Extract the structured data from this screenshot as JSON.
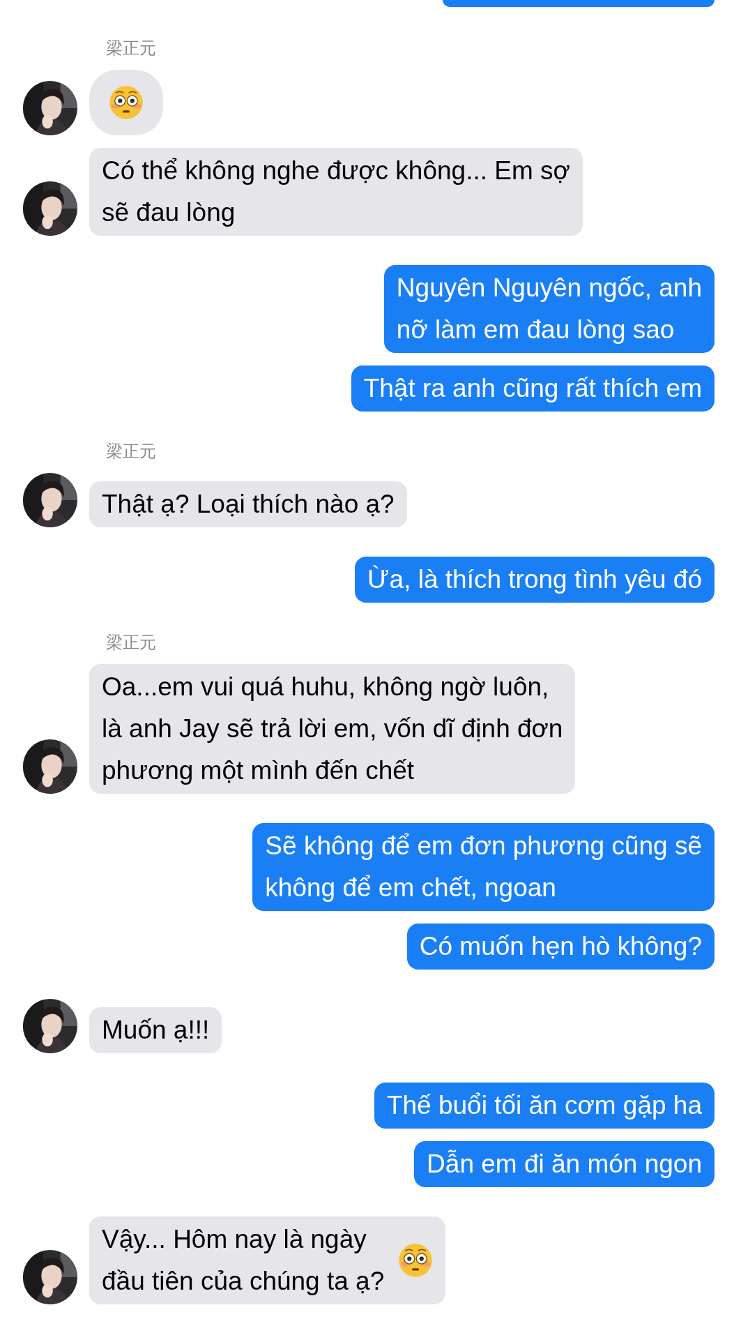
{
  "messages": [
    {
      "kind": "name",
      "text": "梁正元"
    },
    {
      "kind": "incoming",
      "emoji": true
    },
    {
      "kind": "incoming",
      "lines": [
        "Có thể không nghe được không... Em sợ",
        "sẽ đau lòng"
      ]
    },
    {
      "kind": "outgoing",
      "lines": [
        "Nguyên Nguyên ngốc, anh",
        "nỡ làm em đau lòng sao"
      ]
    },
    {
      "kind": "outgoing",
      "lines": [
        "Thật ra anh cũng rất thích em"
      ]
    },
    {
      "kind": "name",
      "text": "梁正元"
    },
    {
      "kind": "incoming",
      "lines": [
        "Thật ạ? Loại thích nào ạ?"
      ]
    },
    {
      "kind": "outgoing",
      "lines": [
        "Ừa, là thích trong tình yêu đó"
      ]
    },
    {
      "kind": "name",
      "text": "梁正元"
    },
    {
      "kind": "incoming",
      "lines": [
        "Oa...em vui quá huhu, không ngờ luôn,",
        "là anh Jay sẽ trả lời em, vốn dĩ định đơn",
        "phương một mình đến chết"
      ]
    },
    {
      "kind": "outgoing",
      "lines": [
        "Sẽ không để em đơn phương cũng sẽ",
        "không để em chết, ngoan"
      ]
    },
    {
      "kind": "outgoing",
      "lines": [
        "Có muốn hẹn hò không?"
      ]
    },
    {
      "kind": "incoming",
      "lines": [
        "Muốn ạ!!!"
      ]
    },
    {
      "kind": "outgoing",
      "lines": [
        "Thế buổi tối ăn cơm gặp ha"
      ]
    },
    {
      "kind": "outgoing",
      "lines": [
        "Dẫn em đi ăn món ngon"
      ]
    },
    {
      "kind": "incoming",
      "lines": [
        "Vậy... Hôm nay là ngày",
        "đầu tiên của chúng ta ạ?"
      ],
      "emoji": true
    }
  ]
}
